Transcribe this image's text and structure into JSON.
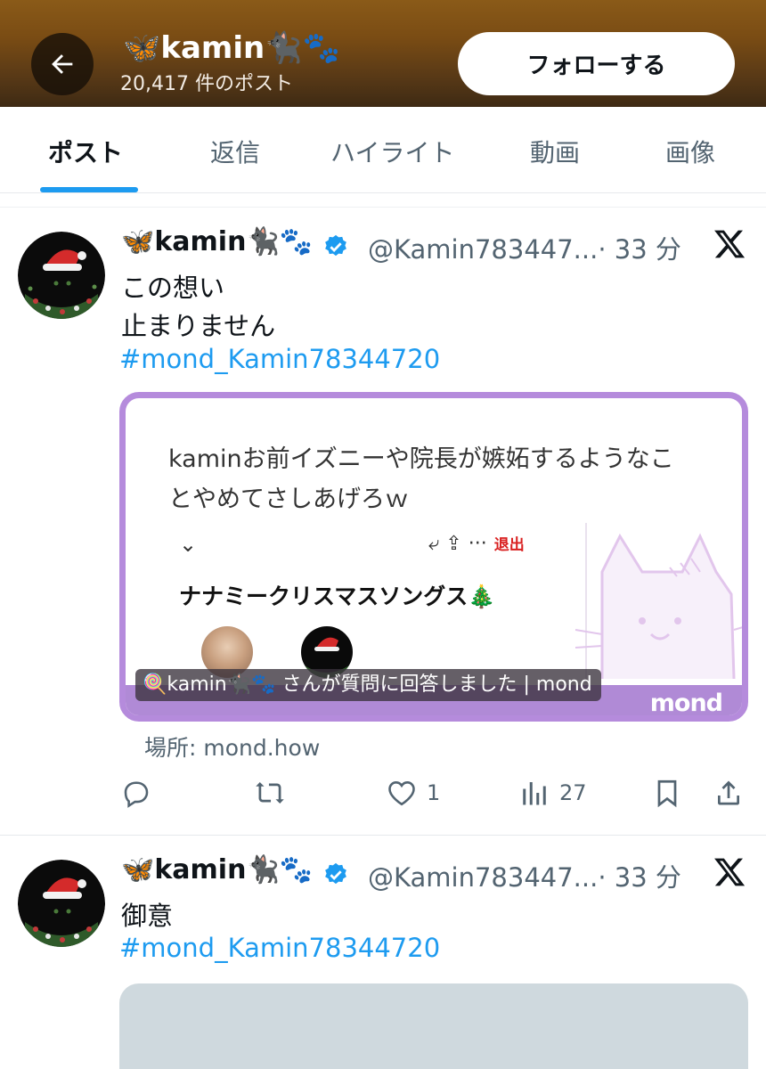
{
  "header": {
    "profile_name": "🦋kamin🐈‍⬛🐾",
    "post_count": "20,417 件のポスト",
    "follow_label": "フォローする"
  },
  "tabs": [
    {
      "label": "ポスト",
      "active": true
    },
    {
      "label": "返信",
      "active": false
    },
    {
      "label": "ハイライト",
      "active": false
    },
    {
      "label": "動画",
      "active": false
    },
    {
      "label": "画像",
      "active": false
    }
  ],
  "tweets": [
    {
      "display_name": "🦋kamin🐈‍⬛🐾",
      "handle": "@Kamin783447...",
      "time": "· 33 分",
      "lines": [
        "この想い",
        "止まりません"
      ],
      "hashtag": "#mond_Kamin78344720",
      "card": {
        "question": [
          "kaminお前イズニーや院長が嫉妬するようなこ",
          "とやめてさしあげろｗ"
        ],
        "menu_icon": "chevron-down-icon",
        "actions": "⤶ ⇪ ···",
        "leave": "退出",
        "title": "ナナミークリスマスソングス🎄",
        "caption": "🍭kamin🐈‍⬛🐾 さんが質問に回答しました | mond",
        "logo": "mond"
      },
      "source": "場所: mond.how",
      "stats": {
        "replies": "",
        "reposts": "",
        "likes": "1",
        "views": "27"
      }
    },
    {
      "display_name": "🦋kamin🐈‍⬛🐾",
      "handle": "@Kamin783447...",
      "time": "· 33 分",
      "lines": [
        "御意"
      ],
      "hashtag": "#mond_Kamin78344720"
    }
  ],
  "colors": {
    "accent": "#1d9bf0",
    "card_border": "#b58bdc",
    "secondary_text": "#536471"
  }
}
